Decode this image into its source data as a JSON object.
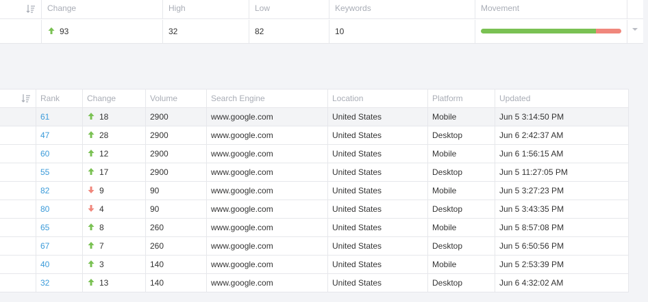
{
  "summary": {
    "headers": {
      "change": "Change",
      "high": "High",
      "low": "Low",
      "keywords": "Keywords",
      "movement": "Movement"
    },
    "row": {
      "change": "93",
      "change_direction": "up",
      "high": "32",
      "low": "82",
      "keywords": "10",
      "movement_up_fraction": 0.82
    }
  },
  "table": {
    "headers": {
      "rank": "Rank",
      "change": "Change",
      "volume": "Volume",
      "search_engine": "Search Engine",
      "location": "Location",
      "platform": "Platform",
      "updated": "Updated"
    },
    "rows": [
      {
        "rank": "61",
        "dir": "up",
        "change": "18",
        "volume": "2900",
        "engine": "www.google.com",
        "location": "United States",
        "platform": "Mobile",
        "updated": "Jun 5 3:14:50 PM"
      },
      {
        "rank": "47",
        "dir": "up",
        "change": "28",
        "volume": "2900",
        "engine": "www.google.com",
        "location": "United States",
        "platform": "Desktop",
        "updated": "Jun 6 2:42:37 AM"
      },
      {
        "rank": "60",
        "dir": "up",
        "change": "12",
        "volume": "2900",
        "engine": "www.google.com",
        "location": "United States",
        "platform": "Mobile",
        "updated": "Jun 6 1:56:15 AM"
      },
      {
        "rank": "55",
        "dir": "up",
        "change": "17",
        "volume": "2900",
        "engine": "www.google.com",
        "location": "United States",
        "platform": "Desktop",
        "updated": "Jun 5 11:27:05 PM"
      },
      {
        "rank": "82",
        "dir": "down",
        "change": "9",
        "volume": "90",
        "engine": "www.google.com",
        "location": "United States",
        "platform": "Mobile",
        "updated": "Jun 5 3:27:23 PM"
      },
      {
        "rank": "80",
        "dir": "down",
        "change": "4",
        "volume": "90",
        "engine": "www.google.com",
        "location": "United States",
        "platform": "Desktop",
        "updated": "Jun 5 3:43:35 PM"
      },
      {
        "rank": "65",
        "dir": "up",
        "change": "8",
        "volume": "260",
        "engine": "www.google.com",
        "location": "United States",
        "platform": "Mobile",
        "updated": "Jun 5 8:57:08 PM"
      },
      {
        "rank": "67",
        "dir": "up",
        "change": "7",
        "volume": "260",
        "engine": "www.google.com",
        "location": "United States",
        "platform": "Desktop",
        "updated": "Jun 5 6:50:56 PM"
      },
      {
        "rank": "40",
        "dir": "up",
        "change": "3",
        "volume": "140",
        "engine": "www.google.com",
        "location": "United States",
        "platform": "Mobile",
        "updated": "Jun 5 2:53:39 PM"
      },
      {
        "rank": "32",
        "dir": "up",
        "change": "13",
        "volume": "140",
        "engine": "www.google.com",
        "location": "United States",
        "platform": "Desktop",
        "updated": "Jun 6 4:32:02 AM"
      }
    ]
  },
  "colors": {
    "up": "#7ac153",
    "down": "#f0877c",
    "rank_link": "#3a9ad9",
    "header_text": "#a9adb6"
  },
  "icons": {
    "sort": "sort-descending-icon",
    "up": "arrow-up-icon",
    "down": "arrow-down-icon",
    "expand": "chevron-down-icon"
  }
}
